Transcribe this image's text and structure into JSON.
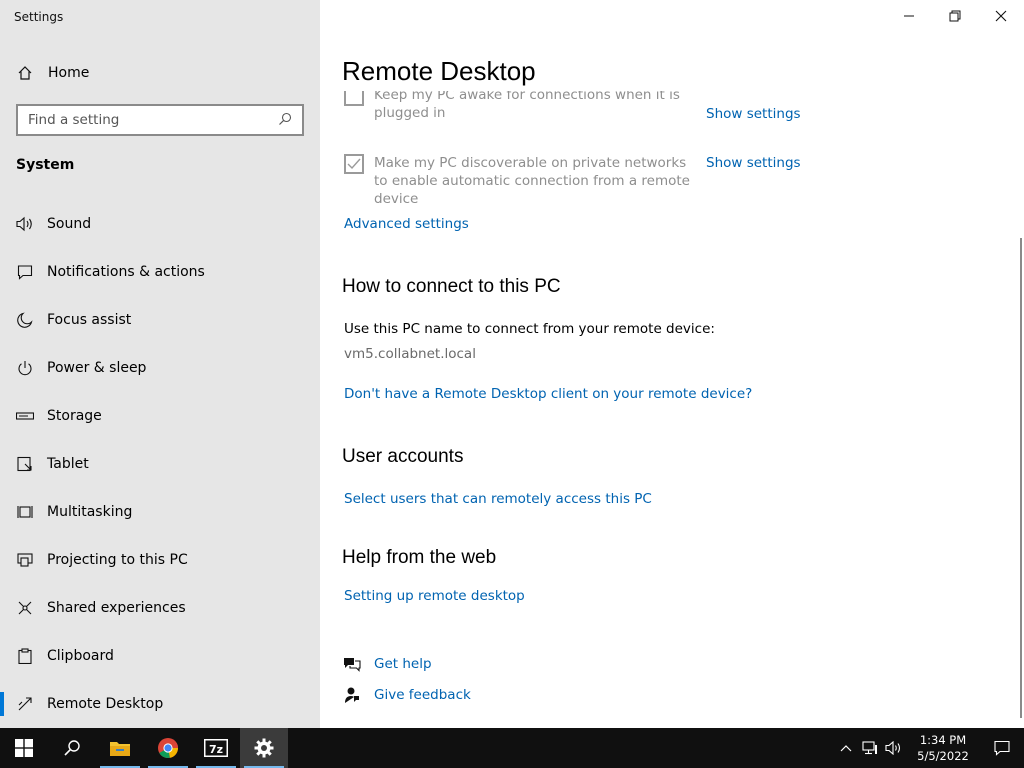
{
  "app": {
    "title": "Settings"
  },
  "sidebar": {
    "home_label": "Home",
    "search_placeholder": "Find a setting",
    "section_label": "System",
    "items": [
      {
        "label": "Sound",
        "icon": "speaker-icon"
      },
      {
        "label": "Notifications & actions",
        "icon": "notification-icon"
      },
      {
        "label": "Focus assist",
        "icon": "moon-icon"
      },
      {
        "label": "Power & sleep",
        "icon": "power-icon"
      },
      {
        "label": "Storage",
        "icon": "storage-icon"
      },
      {
        "label": "Tablet",
        "icon": "tablet-icon"
      },
      {
        "label": "Multitasking",
        "icon": "multitasking-icon"
      },
      {
        "label": "Projecting to this PC",
        "icon": "projecting-icon"
      },
      {
        "label": "Shared experiences",
        "icon": "shared-experiences-icon"
      },
      {
        "label": "Clipboard",
        "icon": "clipboard-icon"
      },
      {
        "label": "Remote Desktop",
        "icon": "remote-desktop-icon",
        "active": true
      }
    ]
  },
  "main": {
    "title": "Remote Desktop",
    "options": [
      {
        "text": "Keep my PC awake for connections when it is plugged in",
        "checked": false,
        "link": "Show settings"
      },
      {
        "text": "Make my PC discoverable on private networks to enable automatic connection from a remote device",
        "checked": true,
        "link": "Show settings"
      }
    ],
    "advanced_link": "Advanced settings",
    "connect": {
      "heading": "How to connect to this PC",
      "instruction": "Use this PC name to connect from your remote device:",
      "pc_name": "vm5.collabnet.local",
      "client_link": "Don't have a Remote Desktop client on your remote device?"
    },
    "accounts": {
      "heading": "User accounts",
      "link": "Select users that can remotely access this PC"
    },
    "help": {
      "heading": "Help from the web",
      "link": "Setting up remote desktop"
    },
    "get_help": "Get help",
    "give_feedback": "Give feedback"
  },
  "taskbar": {
    "time": "1:34 PM",
    "date": "5/5/2022",
    "apps": [
      "start-icon",
      "search-icon",
      "file-explorer-icon",
      "chrome-icon",
      "7zip-icon",
      "settings-icon"
    ]
  },
  "colors": {
    "accent": "#0078d7",
    "link": "#0063b1",
    "sidebar_bg": "#e6e6e6",
    "taskbar_bg": "#101010"
  }
}
